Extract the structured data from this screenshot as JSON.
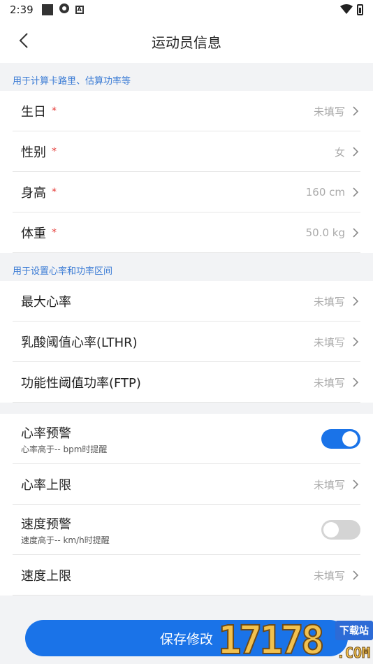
{
  "status_bar": {
    "time": "2:39"
  },
  "nav": {
    "title": "运动员信息"
  },
  "section1": {
    "caption": "用于计算卡路里、估算功率等",
    "rows": [
      {
        "label": "生日",
        "required": "*",
        "value": "未填写"
      },
      {
        "label": "性别",
        "required": "*",
        "value": "女"
      },
      {
        "label": "身高",
        "required": "*",
        "value": "160 cm"
      },
      {
        "label": "体重",
        "required": "*",
        "value": "50.0 kg"
      }
    ]
  },
  "section2": {
    "caption": "用于设置心率和功率区间",
    "rows": [
      {
        "label": "最大心率",
        "value": "未填写"
      },
      {
        "label": "乳酸阈值心率(LTHR)",
        "value": "未填写"
      },
      {
        "label": "功能性阈值功率(FTP)",
        "value": "未填写"
      }
    ]
  },
  "section3": {
    "hr_alert": {
      "label": "心率预警",
      "sub": "心率高于-- bpm时提醒",
      "enabled": true
    },
    "hr_limit": {
      "label": "心率上限",
      "value": "未填写"
    },
    "speed_alert": {
      "label": "速度预警",
      "sub": "速度高于-- km/h时提醒",
      "enabled": false
    },
    "speed_limit": {
      "label": "速度上限",
      "value": "未填写"
    }
  },
  "save_button": {
    "label": "保存修改"
  },
  "watermark": {
    "number": "17178",
    "tag": "下载站",
    "domain": ".COM"
  },
  "colors": {
    "accent": "#1a73e8",
    "caption": "#3a7bd5",
    "required": "#e53935",
    "background": "#f2f3f5"
  }
}
